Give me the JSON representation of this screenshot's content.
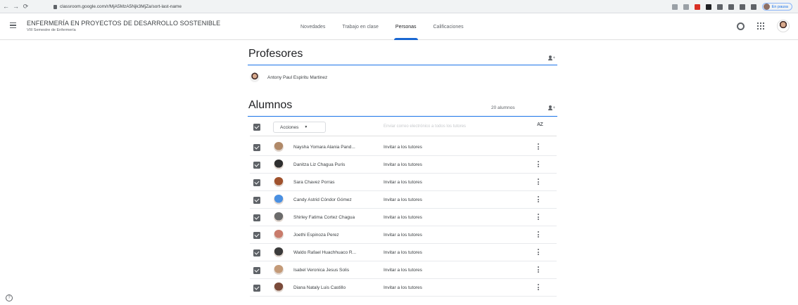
{
  "browser": {
    "url": "classroom.google.com/r/MjA5MzA5Njk3MjZa/sort-last-name",
    "profile_label": "En pausa"
  },
  "header": {
    "class_title": "ENFERMERÍA EN PROYECTOS DE DESARROLLO SOSTENIBLE",
    "class_subtitle": "VIII Semestre de Enfermería",
    "tabs": [
      {
        "label": "Novedades",
        "active": false
      },
      {
        "label": "Trabajo en clase",
        "active": false
      },
      {
        "label": "Personas",
        "active": true
      },
      {
        "label": "Calificaciones",
        "active": false
      }
    ]
  },
  "teachers": {
    "title": "Profesores",
    "items": [
      {
        "name": "Antony Paul Espiritu Martinez"
      }
    ]
  },
  "students": {
    "title": "Alumnos",
    "count_label": "20 alumnos",
    "actions_label": "Acciones",
    "email_all_label": "Enviar correo electrónico a todos los tutores",
    "sort_label": "AZ",
    "invite_label": "Invitar a los tutores",
    "items": [
      {
        "name": "Naysha Yomara Alania Pand...",
        "avatar_color": "#b08968"
      },
      {
        "name": "Danitza Liz Chagua Puris",
        "avatar_color": "#2f2f2f"
      },
      {
        "name": "Sara Chavez Porras",
        "avatar_color": "#a0522d"
      },
      {
        "name": "Candy Astrid Cóndor Gómez",
        "avatar_color": "#4a90e2"
      },
      {
        "name": "Shirley Fatima Cortez Chagua",
        "avatar_color": "#6b6b6b"
      },
      {
        "name": "Joethi Espinoza Perez",
        "avatar_color": "#c97b6b"
      },
      {
        "name": "Waldo Rafael Huachhuaco R...",
        "avatar_color": "#3b3b3b"
      },
      {
        "name": "Isabel Veronica Jesus Solis",
        "avatar_color": "#c49a78"
      },
      {
        "name": "Diana Nataly Luis Castillo",
        "avatar_color": "#7a4a3a"
      }
    ]
  },
  "colors": {
    "accent": "#1967d2",
    "text": "#3c4043",
    "checkbox": "#5f6368"
  }
}
